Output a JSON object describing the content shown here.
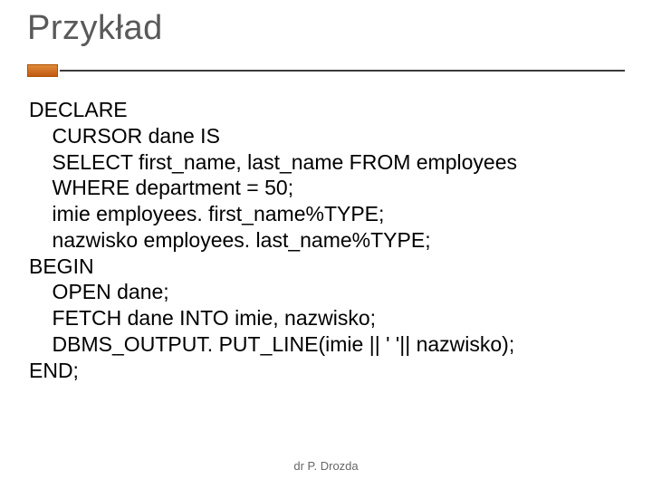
{
  "title": "Przykład",
  "code": {
    "l1": "DECLARE",
    "l2": "    CURSOR dane IS",
    "l3": "    SELECT first_name, last_name FROM employees",
    "l4": "    WHERE department = 50;",
    "l5": "    imie employees. first_name%TYPE;",
    "l6": "    nazwisko employees. last_name%TYPE;",
    "l7": "BEGIN",
    "l8": "    OPEN dane;",
    "l9": "    FETCH dane INTO imie, nazwisko;",
    "l10": "    DBMS_OUTPUT. PUT_LINE(imie || ' '|| nazwisko);",
    "l11": "END;"
  },
  "footer": "dr P. Drozda"
}
